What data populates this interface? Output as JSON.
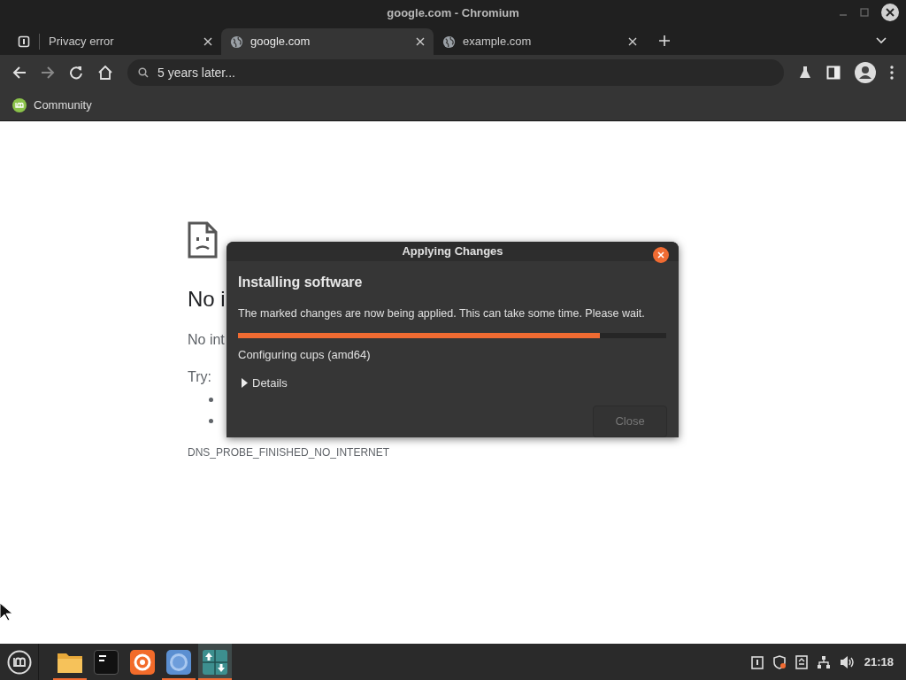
{
  "window": {
    "title": "google.com - Chromium"
  },
  "tabs": [
    {
      "title": "Privacy error",
      "kind": "blocked",
      "selected": false
    },
    {
      "title": "google.com",
      "kind": "globe",
      "selected": true
    },
    {
      "title": "example.com",
      "kind": "globe",
      "selected": false
    }
  ],
  "omnibox": {
    "value": "5 years later..."
  },
  "bookmarks": [
    {
      "label": "Community"
    }
  ],
  "page": {
    "heading": "No i",
    "subtitle": "No int",
    "try_label": "Try:",
    "error_code": "DNS_PROBE_FINISHED_NO_INTERNET"
  },
  "dialog": {
    "title": "Applying Changes",
    "heading": "Installing software",
    "message": "The marked changes are now being applied. This can take some time. Please wait.",
    "progress": {
      "level": 0.845
    },
    "status": "Configuring cups (amd64)",
    "details": {
      "label": "Details",
      "expanded": false
    },
    "button": {
      "label": "Close",
      "disabled": true
    }
  },
  "taskbar": {
    "apps": [
      {
        "kind": "files",
        "running": true
      },
      {
        "kind": "terminal",
        "running": false
      },
      {
        "kind": "firefox",
        "running": false
      },
      {
        "kind": "chromium",
        "running": true
      },
      {
        "kind": "updates",
        "running": true
      }
    ],
    "clock": "21:18"
  }
}
